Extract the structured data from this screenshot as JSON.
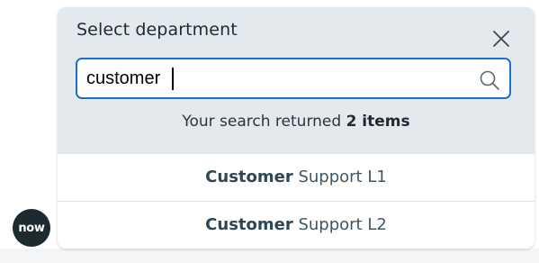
{
  "dialog": {
    "title": "Select department",
    "close_icon": "close-icon"
  },
  "search": {
    "value": "customer",
    "icon": "search-icon"
  },
  "summary": {
    "prefix": "Your search returned ",
    "count_text": "2 items"
  },
  "results": [
    {
      "match": "Customer",
      "rest": " Support L1"
    },
    {
      "match": "Customer",
      "rest": " Support L2"
    }
  ],
  "logo": {
    "text": "now"
  },
  "colors": {
    "header_bg": "#e4e9ed",
    "focus_border": "#1a6fd1",
    "logo_bg": "#1d2b31"
  }
}
